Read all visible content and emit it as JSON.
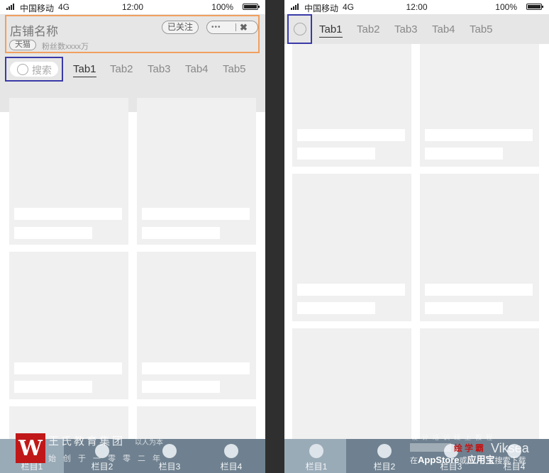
{
  "status_bar": {
    "carrier": "中国移动",
    "network": "4G",
    "time": "12:00",
    "battery": "100%"
  },
  "left_screen": {
    "shop": {
      "name": "店铺名称",
      "follow_label": "已关注",
      "more_label": "•••",
      "close_label": "✖",
      "badge": "天猫",
      "fans": "粉丝数xxxx万"
    },
    "search": {
      "placeholder": "搜索"
    },
    "tabs": [
      "Tab1",
      "Tab2",
      "Tab3",
      "Tab4",
      "Tab5"
    ],
    "active_tab": "Tab1",
    "bottom_nav": [
      "栏目1",
      "栏目2",
      "栏目3",
      "栏目4"
    ]
  },
  "right_screen": {
    "tabs": [
      "Tab1",
      "Tab2",
      "Tab3",
      "Tab4",
      "Tab5"
    ],
    "active_tab": "Tab1",
    "bottom_nav": [
      "栏目1",
      "栏目2",
      "栏目3",
      "栏目4"
    ]
  },
  "watermarks": {
    "left": {
      "logo": "W",
      "title": "王氏教育集团",
      "slogan": "以人为本",
      "sub": "始创于一零零二年"
    },
    "right": {
      "brand": "绘学霸",
      "hint_prefix": "在",
      "appstore": "AppStore",
      "hint_mid": "或",
      "taobao": "应用宝",
      "hint_suffix": "搜索下载",
      "viksea": "Viksea",
      "faint": "设计培训线上教程"
    }
  },
  "colors": {
    "shop_frame": "#f0a060",
    "search_frame": "#3a3aa8",
    "bottom_bar": "#6f8190",
    "bottom_active": "#9aabb8",
    "placeholder": "#f0f0f0"
  },
  "icons": [
    "signal-icon",
    "battery-icon",
    "search-icon",
    "more-icon",
    "close-icon",
    "nav-dot-icon"
  ]
}
